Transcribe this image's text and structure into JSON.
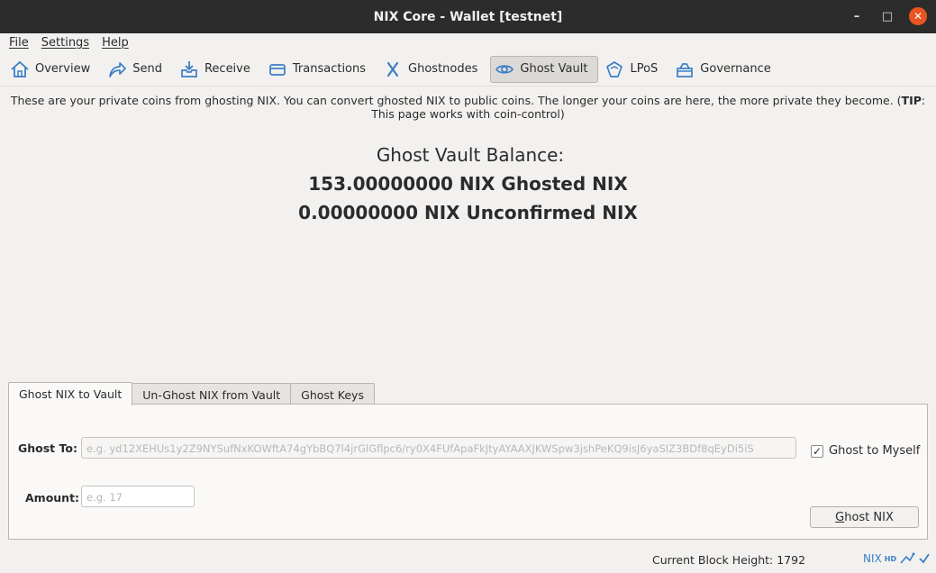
{
  "window": {
    "title": "NIX Core - Wallet [testnet]"
  },
  "menu": {
    "file": "File",
    "settings": "Settings",
    "help": "Help"
  },
  "toolbar": {
    "items": [
      {
        "label": "Overview",
        "icon": "home-icon"
      },
      {
        "label": "Send",
        "icon": "send-arrow-icon"
      },
      {
        "label": "Receive",
        "icon": "receive-inbox-icon"
      },
      {
        "label": "Transactions",
        "icon": "credit-card-icon"
      },
      {
        "label": "Ghostnodes",
        "icon": "ghostnodes-x-icon"
      },
      {
        "label": "Ghost Vault",
        "icon": "eye-icon"
      },
      {
        "label": "LPoS",
        "icon": "lpos-shield-icon"
      },
      {
        "label": "Governance",
        "icon": "governance-icon"
      }
    ],
    "active": "Ghost Vault"
  },
  "tip": {
    "text_before": "These are your private coins from ghosting NIX. You can convert ghosted NIX to public coins. The longer your coins are here, the more private they become. (",
    "bold": "TIP",
    "text_after": ": This page works with coin-control)"
  },
  "balance": {
    "title": "Ghost Vault Balance:",
    "ghosted": "153.00000000 NIX Ghosted NIX",
    "unconfirmed": "0.00000000 NIX Unconfirmed NIX"
  },
  "tabs": {
    "ghost_to_vault": "Ghost NIX to Vault",
    "unghost": "Un-Ghost NIX from Vault",
    "keys": "Ghost Keys"
  },
  "form": {
    "ghost_to_label": "Ghost To:",
    "ghost_to_placeholder": "e.g. yd12XEHUs1y2Z9NYSufNxKOWftA74gYbBQ7l4jrGlGflpc6/ry0X4FUfApaFkJtyAYAAXJKWSpw3jshPeKQ9isJ6yaSIZ3BDf8qEyDi5iS",
    "ghost_to_myself_label": "Ghost to Myself",
    "ghost_to_myself_checked": true,
    "amount_label": "Amount:",
    "amount_placeholder": "e.g. 17",
    "ghost_button_prefix": "G",
    "ghost_button_rest": "host NIX"
  },
  "status": {
    "block_height": "Current Block Height: 1792",
    "unit": "NIX",
    "hd": "HD"
  }
}
